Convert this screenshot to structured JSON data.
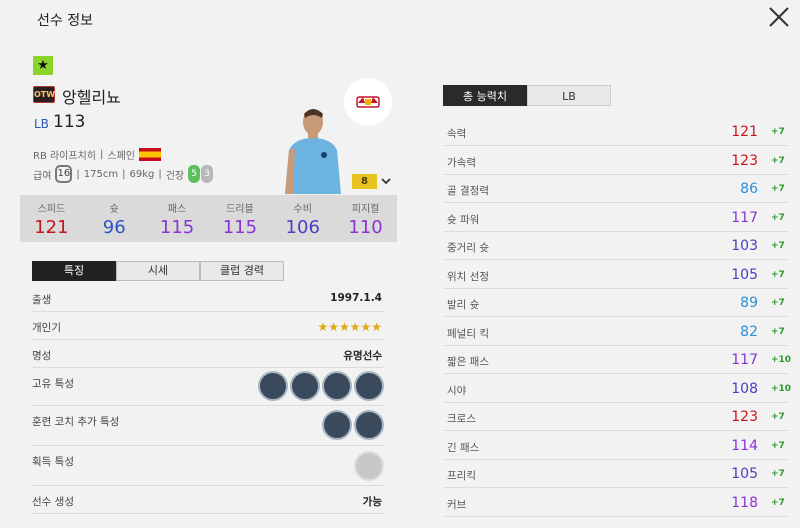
{
  "header": {
    "title": "선수 정보"
  },
  "player": {
    "badge": "★",
    "season_tag": "OTW",
    "name": "앙헬리뇨",
    "position": "LB",
    "ovr": "113",
    "club_pos": "RB 라이프치히",
    "sep1": "|",
    "nation": "스페인",
    "salary_label": "급여",
    "salary": "16",
    "height": "175cm",
    "weight": "69kg",
    "body": "건장",
    "foot_left": "5",
    "foot_right": "3",
    "enhance": "8"
  },
  "main_stats": [
    {
      "label": "스피드",
      "value": "121",
      "color": "#c4161c"
    },
    {
      "label": "슛",
      "value": "96",
      "color": "#2b55c7"
    },
    {
      "label": "패스",
      "value": "115",
      "color": "#8a33d6"
    },
    {
      "label": "드리블",
      "value": "115",
      "color": "#8a33d6"
    },
    {
      "label": "수비",
      "value": "106",
      "color": "#4a3fc4"
    },
    {
      "label": "피지컬",
      "value": "110",
      "color": "#8a33d6"
    }
  ],
  "tabs": [
    "특징",
    "시세",
    "클럽 경력"
  ],
  "info": {
    "birth_label": "출생",
    "birth": "1997.1.4",
    "popularity_label": "개인기",
    "fame_label": "명성",
    "fame": "유명선수",
    "traits_label": "고유 특성",
    "coach_label": "훈련 코치 추가 특성",
    "acquired_label": "획득 특성",
    "create_label": "선수 생성",
    "create": "가능"
  },
  "right_tabs": [
    "총 능력치",
    "LB"
  ],
  "detail_stats": [
    {
      "name": "속력",
      "value": "121",
      "bonus": "+7",
      "color": "#c4161c"
    },
    {
      "name": "가속력",
      "value": "123",
      "bonus": "+7",
      "color": "#c4161c"
    },
    {
      "name": "골 결정력",
      "value": "86",
      "bonus": "+7",
      "color": "#2a8fd6"
    },
    {
      "name": "슛 파워",
      "value": "117",
      "bonus": "+7",
      "color": "#8a33d6"
    },
    {
      "name": "중거리 슛",
      "value": "103",
      "bonus": "+7",
      "color": "#4a3fc4"
    },
    {
      "name": "위치 선정",
      "value": "105",
      "bonus": "+7",
      "color": "#4a3fc4"
    },
    {
      "name": "발리 슛",
      "value": "89",
      "bonus": "+7",
      "color": "#2a8fd6"
    },
    {
      "name": "페널티 킥",
      "value": "82",
      "bonus": "+7",
      "color": "#2a8fd6"
    },
    {
      "name": "짧은 패스",
      "value": "117",
      "bonus": "+10",
      "color": "#8a33d6"
    },
    {
      "name": "시야",
      "value": "108",
      "bonus": "+10",
      "color": "#4a3fc4"
    },
    {
      "name": "크로스",
      "value": "123",
      "bonus": "+7",
      "color": "#c4161c"
    },
    {
      "name": "긴 패스",
      "value": "114",
      "bonus": "+7",
      "color": "#8a33d6"
    },
    {
      "name": "프리킥",
      "value": "105",
      "bonus": "+7",
      "color": "#4a3fc4"
    },
    {
      "name": "커브",
      "value": "118",
      "bonus": "+7",
      "color": "#8a33d6"
    }
  ]
}
